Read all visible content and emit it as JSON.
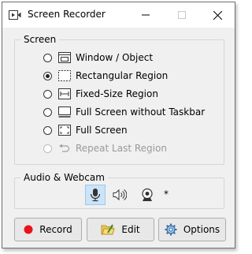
{
  "window": {
    "title": "Screen Recorder"
  },
  "screen": {
    "legend": "Screen",
    "options": [
      {
        "label": "Window / Object",
        "icon": "window-icon",
        "checked": false,
        "disabled": false
      },
      {
        "label": "Rectangular Region",
        "icon": "region-icon",
        "checked": true,
        "disabled": false
      },
      {
        "label": "Fixed-Size Region",
        "icon": "fixed-size-icon",
        "checked": false,
        "disabled": false
      },
      {
        "label": "Full Screen without Taskbar",
        "icon": "screen-no-taskbar-icon",
        "checked": false,
        "disabled": false
      },
      {
        "label": "Full Screen",
        "icon": "full-screen-icon",
        "checked": false,
        "disabled": false
      },
      {
        "label": "Repeat Last Region",
        "icon": "repeat-icon",
        "checked": false,
        "disabled": true
      }
    ]
  },
  "audio_webcam": {
    "legend": "Audio & Webcam",
    "microphone_active": true,
    "extra": "*"
  },
  "buttons": {
    "record": "Record",
    "edit": "Edit",
    "options": "Options"
  },
  "colors": {
    "record_dot": "#e8131b",
    "active_bg": "#cce4f7"
  }
}
